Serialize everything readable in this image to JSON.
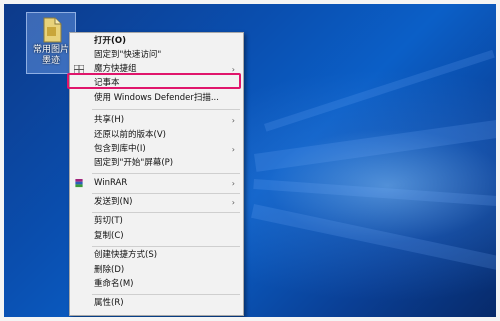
{
  "desktop": {
    "icon_label": "常用图片\n墨迹",
    "icon_label_line1": "常用图片",
    "icon_label_line2": "墨迹"
  },
  "context_menu": {
    "items": [
      {
        "label": "打开(O)",
        "bold": true,
        "arrow": false
      },
      {
        "label": "固定到\"快速访问\"",
        "arrow": false
      },
      {
        "label": "魔方快捷组",
        "arrow": true,
        "icon": "grid-icon"
      },
      {
        "label": "记事本",
        "arrow": false,
        "highlighted": true
      },
      {
        "label": "使用 Windows Defender扫描...",
        "arrow": false
      },
      {
        "label": "共享(H)",
        "arrow": true
      },
      {
        "label": "还原以前的版本(V)",
        "arrow": false
      },
      {
        "label": "包含到库中(I)",
        "arrow": true
      },
      {
        "label": "固定到\"开始\"屏幕(P)",
        "arrow": false
      },
      {
        "label": "WinRAR",
        "arrow": true,
        "icon": "winrar-icon"
      },
      {
        "label": "发送到(N)",
        "arrow": true
      },
      {
        "label": "剪切(T)",
        "arrow": false
      },
      {
        "label": "复制(C)",
        "arrow": false
      },
      {
        "label": "创建快捷方式(S)",
        "arrow": false
      },
      {
        "label": "删除(D)",
        "arrow": false
      },
      {
        "label": "重命名(M)",
        "arrow": false
      },
      {
        "label": "属性(R)",
        "arrow": false
      }
    ]
  },
  "colors": {
    "highlight_border": "#e0156b",
    "menu_background": "#f2f2f2"
  }
}
